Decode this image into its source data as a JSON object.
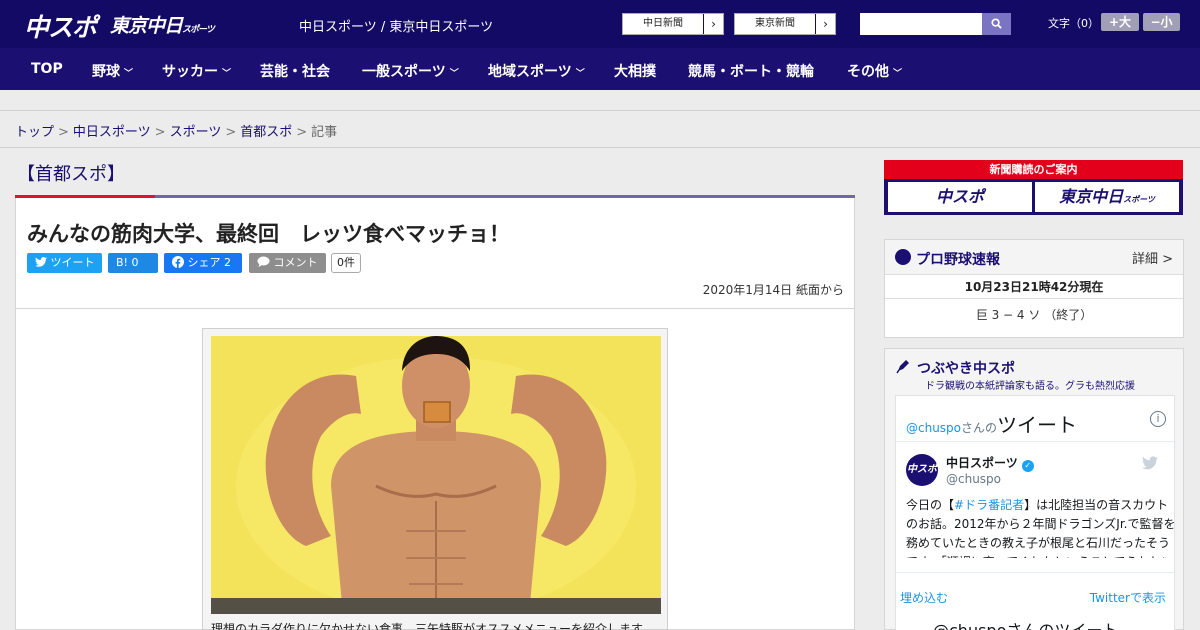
{
  "header": {
    "logo_chuspo": "中スポ",
    "logo_tokyo": "東京中日",
    "logo_tokyo_small": "スポーツ",
    "sites": "中日スポーツ / 東京中日スポーツ",
    "paper_links": [
      "中日新聞",
      "東京新聞"
    ],
    "search_placeholder": "",
    "font_label": "文字（0）",
    "font_bigger": "+大",
    "font_smaller": "−小"
  },
  "nav": {
    "items": [
      {
        "label": "TOP",
        "caret": false
      },
      {
        "label": "野球",
        "caret": true
      },
      {
        "label": "サッカー",
        "caret": true
      },
      {
        "label": "芸能・社会",
        "caret": false
      },
      {
        "label": "一般スポーツ",
        "caret": true
      },
      {
        "label": "地域スポーツ",
        "caret": true
      },
      {
        "label": "大相撲",
        "caret": false
      },
      {
        "label": "競馬・ボート・競輪",
        "caret": false
      },
      {
        "label": "その他",
        "caret": true
      }
    ]
  },
  "breadcrumb": {
    "items": [
      "トップ",
      "中日スポーツ",
      "スポーツ",
      "首都スポ"
    ],
    "current": "記事"
  },
  "section": {
    "title": "【首都スポ】"
  },
  "article": {
    "headline": "みんなの筋肉大学、最終回　レッツ食べマッチョ！",
    "share": {
      "tweet": "ツイート",
      "hatena": "B! 0",
      "facebook": "シェア 2",
      "comment": "コメント",
      "comment_count": "0件"
    },
    "date": "2020年1月14日 紙面から",
    "caption": "理想のカラダ作りに欠かせない食事。三矢特駆がオススメメニューを紹介します"
  },
  "sidebar": {
    "ad": {
      "top": "新聞購読のご案内",
      "left": "中スポ",
      "right": "東京中日",
      "right_small": "スポーツ"
    },
    "baseball": {
      "title": "プロ野球速報",
      "more": "詳細 >",
      "time": "10月23日21時42分現在",
      "score": "巨 3 − 4 ソ （終了）"
    },
    "tweets": {
      "title": "つぶやき中スポ",
      "subtitle": "ドラ観戦の本紙評論家も語る。グラも熱烈応援",
      "handle": "@chuspo",
      "handle_suffix": "さんの",
      "handle_big": "ツイート",
      "info": "i",
      "avatar": "中スポ",
      "name": "中日スポーツ",
      "id": "@chuspo",
      "body_pre": "今日の【",
      "body_tag": "#ドラ番記者",
      "body_post": "】は北陸担当の音スカウトのお話。2012年から２年間ドラゴンズJr.で監督を務めていたときの教え子が根尾と石川だったそうです。「順調に育ってくれたということでうれしいです",
      "embed": "埋め込む",
      "view": "Twitterで表示",
      "bottom": "@chuspoさんのツイート"
    }
  },
  "colors": {
    "header_bg": "#120a64",
    "nav_bg": "#1b1072",
    "accent_red": "#d7182a",
    "twitter_blue": "#1da1f2",
    "photo_bg": "#f3e35a"
  }
}
